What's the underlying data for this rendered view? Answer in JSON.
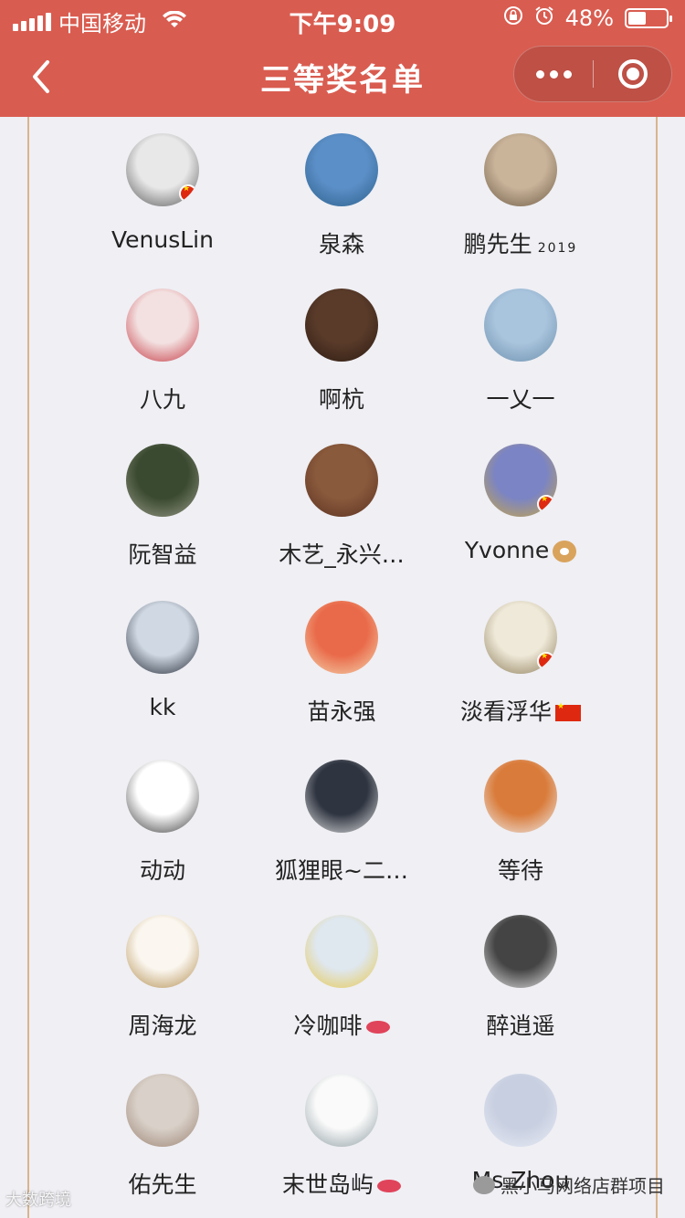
{
  "status_bar": {
    "carrier": "中国移动",
    "time": "下午9:09",
    "battery_percent": "48%",
    "battery_level": 0.48,
    "icons": [
      "signal-icon",
      "wifi-icon",
      "orientation-lock-icon",
      "alarm-icon",
      "battery-icon"
    ]
  },
  "nav": {
    "title": "三等奖名单",
    "back_icon": "chevron-left-icon",
    "more_icon": "more-dots-icon",
    "close_icon": "target-close-icon"
  },
  "colors": {
    "header_bg": "#d95c50",
    "page_bg": "#efeff4",
    "panel_border": "#d8b48c"
  },
  "winners": [
    {
      "name": "VenusLin",
      "suffix": "",
      "emoji": "",
      "badge": true
    },
    {
      "name": "泉森",
      "suffix": "",
      "emoji": "",
      "badge": false
    },
    {
      "name": "鹏先生",
      "suffix": "2019",
      "emoji": "",
      "badge": false
    },
    {
      "name": "八九",
      "suffix": "",
      "emoji": "",
      "badge": false
    },
    {
      "name": "啊杭",
      "suffix": "",
      "emoji": "",
      "badge": false
    },
    {
      "name": "一乂一",
      "suffix": "",
      "emoji": "",
      "badge": false
    },
    {
      "name": "阮智益",
      "suffix": "",
      "emoji": "",
      "badge": false
    },
    {
      "name": "木艺_永兴…",
      "suffix": "",
      "emoji": "",
      "badge": false
    },
    {
      "name": "Yvonne",
      "suffix": "",
      "emoji": "dog",
      "badge": true
    },
    {
      "name": "kk",
      "suffix": "",
      "emoji": "",
      "badge": false
    },
    {
      "name": "苗永强",
      "suffix": "",
      "emoji": "",
      "badge": false
    },
    {
      "name": "淡看浮华",
      "suffix": "",
      "emoji": "flag",
      "badge": true
    },
    {
      "name": "动动",
      "suffix": "",
      "emoji": "",
      "badge": false
    },
    {
      "name": "狐狸眼~二…",
      "suffix": "",
      "emoji": "",
      "badge": false
    },
    {
      "name": "等待",
      "suffix": "",
      "emoji": "",
      "badge": false
    },
    {
      "name": "周海龙",
      "suffix": "",
      "emoji": "",
      "badge": false
    },
    {
      "name": "冷咖啡",
      "suffix": "",
      "emoji": "lips",
      "badge": false
    },
    {
      "name": "醉逍遥",
      "suffix": "",
      "emoji": "",
      "badge": false
    },
    {
      "name": "佑先生",
      "suffix": "",
      "emoji": "",
      "badge": false
    },
    {
      "name": "末世岛屿",
      "suffix": "",
      "emoji": "lips",
      "badge": false
    },
    {
      "name": "Ms.Zhou",
      "suffix": "",
      "emoji": "",
      "badge": false
    }
  ],
  "watermarks": {
    "left": "大数跨境",
    "right": "黑小马网络店群项目"
  }
}
